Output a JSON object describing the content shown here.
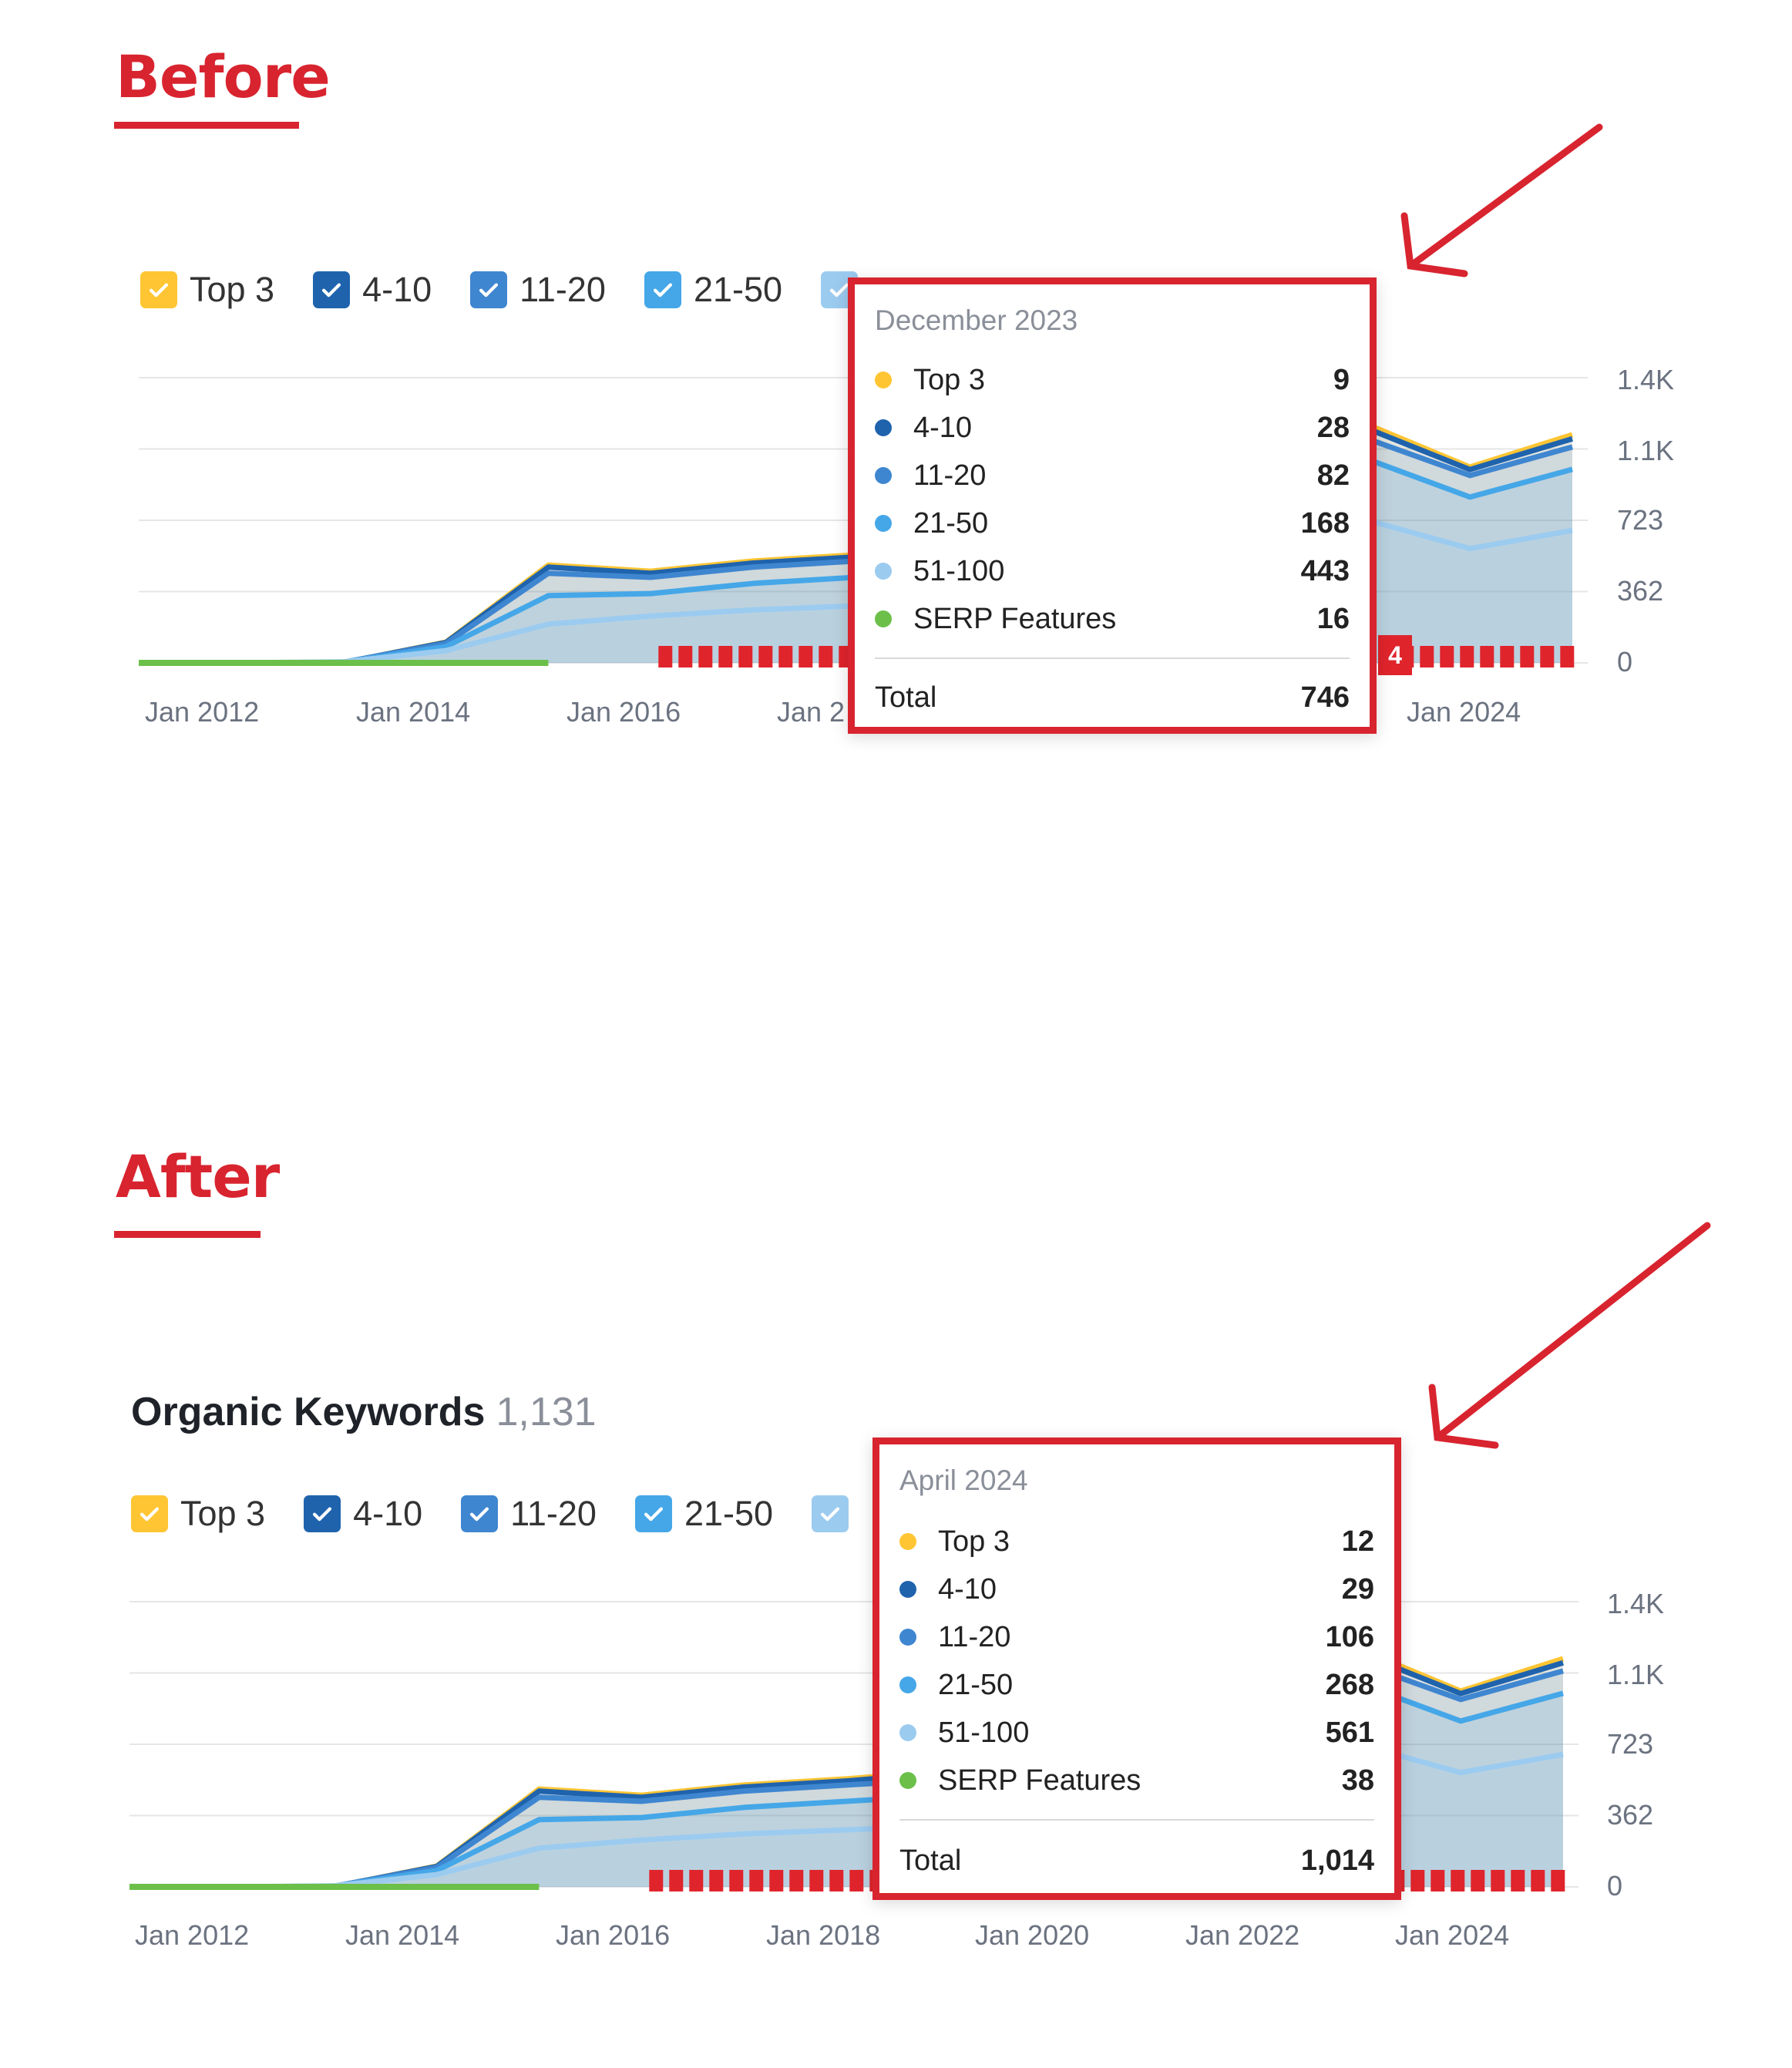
{
  "panels": {
    "before": {
      "heading": "Before",
      "tooltip": {
        "title": "December 2023",
        "rows": [
          {
            "label": "Top 3",
            "value": "9",
            "color": "#ffc533"
          },
          {
            "label": "4-10",
            "value": "28",
            "color": "#1f63ad"
          },
          {
            "label": "11-20",
            "value": "82",
            "color": "#3f86d0"
          },
          {
            "label": "21-50",
            "value": "168",
            "color": "#45a7e8"
          },
          {
            "label": "51-100",
            "value": "443",
            "color": "#9ccbf0"
          },
          {
            "label": "SERP Features",
            "value": "16",
            "color": "#6cc04a"
          }
        ],
        "total_label": "Total",
        "total_value": "746"
      },
      "badge": "4"
    },
    "after": {
      "heading": "After",
      "title": "Organic Keywords",
      "count": "1,131",
      "tooltip": {
        "title": "April 2024",
        "rows": [
          {
            "label": "Top 3",
            "value": "12",
            "color": "#ffc533"
          },
          {
            "label": "4-10",
            "value": "29",
            "color": "#1f63ad"
          },
          {
            "label": "11-20",
            "value": "106",
            "color": "#3f86d0"
          },
          {
            "label": "21-50",
            "value": "268",
            "color": "#45a7e8"
          },
          {
            "label": "51-100",
            "value": "561",
            "color": "#9ccbf0"
          },
          {
            "label": "SERP Features",
            "value": "38",
            "color": "#6cc04a"
          }
        ],
        "total_label": "Total",
        "total_value": "1,014"
      }
    }
  },
  "legend": [
    {
      "label": "Top 3",
      "color": "#ffc533"
    },
    {
      "label": "4-10",
      "color": "#1f63ad"
    },
    {
      "label": "11-20",
      "color": "#3f86d0"
    },
    {
      "label": "21-50",
      "color": "#45a7e8"
    },
    {
      "label": "51-100",
      "color": "#9ccbf0"
    }
  ],
  "y_ticks": [
    "1.4K",
    "1.1K",
    "723",
    "362",
    "0"
  ],
  "x_ticks_before": [
    "Jan 2012",
    "Jan 2014",
    "Jan 2016",
    "Jan 2",
    "Jan 2024"
  ],
  "x_ticks_after": [
    "Jan 2012",
    "Jan 2014",
    "Jan 2016",
    "Jan 2018",
    "Jan 2020",
    "Jan 2022",
    "Jan 2024"
  ],
  "chart_data": [
    {
      "type": "area",
      "title": "",
      "x": [
        "Jan 2012",
        "Jan 2013",
        "Jan 2014",
        "Jan 2015",
        "Jan 2016",
        "Jan 2017",
        "Jan 2018",
        "Jan 2019",
        "Jan 2020",
        "Jan 2021",
        "Jan 2022",
        "Jan 2023",
        "Jan 2024",
        "Apr 2024",
        "Jan 2025"
      ],
      "series": [
        {
          "name": "51-100",
          "values": [
            0,
            0,
            5,
            60,
            190,
            230,
            260,
            280,
            300,
            320,
            340,
            450,
            700,
            561,
            650
          ]
        },
        {
          "name": "21-50",
          "values": [
            0,
            0,
            4,
            80,
            330,
            340,
            390,
            420,
            450,
            480,
            520,
            700,
            1000,
            814,
            950
          ]
        },
        {
          "name": "11-20",
          "values": [
            0,
            0,
            3,
            95,
            440,
            420,
            470,
            500,
            530,
            570,
            620,
            800,
            1100,
            920,
            1060
          ]
        },
        {
          "name": "4-10",
          "values": [
            0,
            0,
            2,
            100,
            470,
            440,
            490,
            520,
            560,
            600,
            650,
            850,
            1150,
            949,
            1100
          ]
        },
        {
          "name": "Top 3",
          "values": [
            0,
            0,
            1,
            102,
            480,
            450,
            500,
            530,
            570,
            610,
            660,
            860,
            1170,
            961,
            1120
          ]
        }
      ],
      "ylim": [
        0,
        1400
      ]
    }
  ]
}
